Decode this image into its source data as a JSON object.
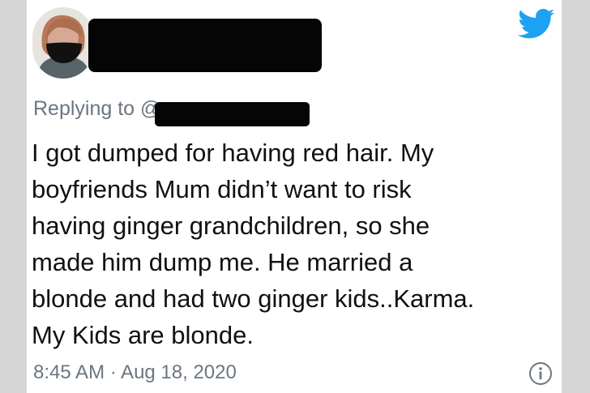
{
  "tweet": {
    "replying_label": "Replying to",
    "replying_partial": "@",
    "text": "I got dumped for having red hair. My\nboyfriends Mum  didn’t want to risk\nhaving ginger grandchildren, so she\nmade him dump me. He married a\nblonde and had two ginger kids..Karma.\nMy Kids are blonde.",
    "timestamp": "8:45 AM · Aug 18, 2020"
  },
  "icons": {
    "brand": "twitter-bird-icon",
    "info": "info-icon"
  },
  "colors": {
    "twitter_blue": "#1DA1F2",
    "secondary_text": "#6B7680",
    "primary_text": "#111111",
    "redaction": "#050505"
  }
}
